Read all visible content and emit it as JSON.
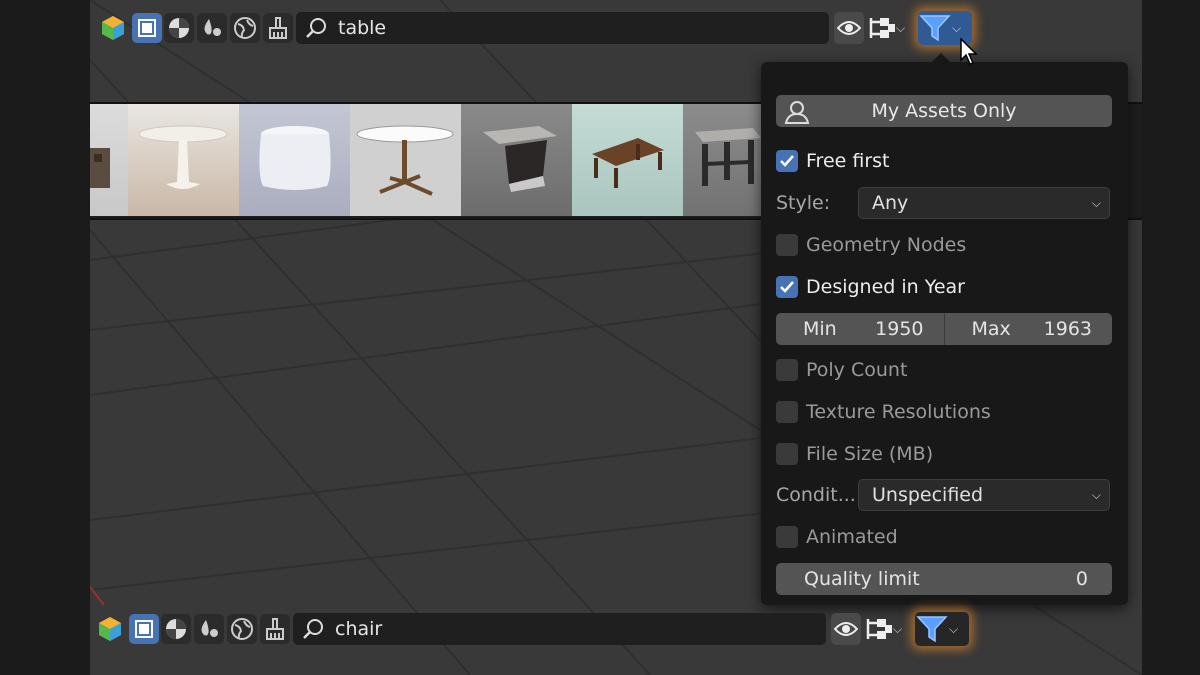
{
  "top_toolbar": {
    "search_value": "table"
  },
  "bottom_toolbar": {
    "search_value": "chair"
  },
  "filter_popup": {
    "my_assets_label": "My Assets Only",
    "free_first": {
      "label": "Free first",
      "checked": true
    },
    "style": {
      "label": "Style:",
      "value": "Any"
    },
    "geometry_nodes": {
      "label": "Geometry Nodes",
      "checked": false
    },
    "designed_in_year": {
      "label": "Designed in Year",
      "checked": true
    },
    "year_range": {
      "min_label": "Min",
      "min_value": "1950",
      "max_label": "Max",
      "max_value": "1963"
    },
    "poly_count": {
      "label": "Poly Count",
      "checked": false
    },
    "texture_resolutions": {
      "label": "Texture Resolutions",
      "checked": false
    },
    "file_size": {
      "label": "File Size (MB)",
      "checked": false
    },
    "condition": {
      "label": "Condit...",
      "value": "Unspecified"
    },
    "animated": {
      "label": "Animated",
      "checked": false
    },
    "quality_limit": {
      "label": "Quality limit",
      "value": "0"
    }
  },
  "colors": {
    "accent": "#4772b3",
    "highlight_glow": "#ff9628",
    "viewport_bg": "#393939",
    "panel_bg": "#181818"
  },
  "icons": [
    "asset-hexagon-icon",
    "select-box-icon",
    "material-sphere-icon",
    "drops-icon",
    "world-icon",
    "brush-icon",
    "search-icon",
    "eye-icon",
    "hierarchy-icon",
    "filter-funnel-icon",
    "user-icon",
    "checkmark-icon",
    "chevron-down-icon",
    "mouse-cursor-icon"
  ]
}
